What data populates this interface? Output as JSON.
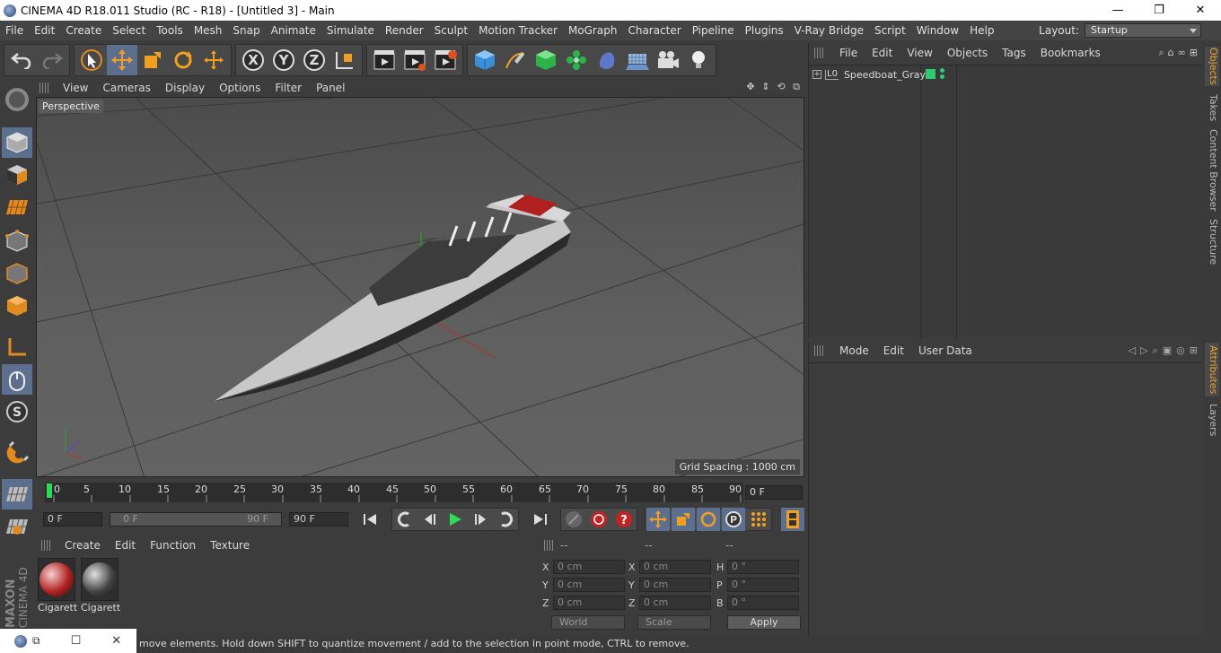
{
  "window": {
    "title": "CINEMA 4D R18.011 Studio (RC - R18) - [Untitled 3] - Main",
    "min_glyph": "—",
    "max_glyph": "❐",
    "close_glyph": "✕"
  },
  "menu": [
    "File",
    "Edit",
    "Create",
    "Select",
    "Tools",
    "Mesh",
    "Snap",
    "Animate",
    "Simulate",
    "Render",
    "Sculpt",
    "Motion Tracker",
    "MoGraph",
    "Character",
    "Pipeline",
    "Plugins",
    "V-Ray Bridge",
    "Script",
    "Window",
    "Help"
  ],
  "layout": {
    "label": "Layout:",
    "value": "Startup"
  },
  "viewport": {
    "menu": [
      "View",
      "Cameras",
      "Display",
      "Options",
      "Filter",
      "Panel"
    ],
    "label": "Perspective",
    "grid_spacing": "Grid Spacing : 1000 cm"
  },
  "timeline": {
    "ticks": [
      "0",
      "5",
      "10",
      "15",
      "20",
      "25",
      "30",
      "35",
      "40",
      "45",
      "50",
      "55",
      "60",
      "65",
      "70",
      "75",
      "80",
      "85",
      "90"
    ],
    "current_frame": "0 F"
  },
  "transport": {
    "start": "0 F",
    "range_start": "0 F",
    "range_end": "90 F",
    "end": "90 F"
  },
  "materials": {
    "menu": [
      "Create",
      "Edit",
      "Function",
      "Texture"
    ],
    "items": [
      {
        "name": "Cigarett",
        "color": "#b22222"
      },
      {
        "name": "Cigarett",
        "color": "#444444"
      }
    ]
  },
  "coords": {
    "headers": [
      "--",
      "--",
      "--"
    ],
    "rows": [
      {
        "l1": "X",
        "v1": "0 cm",
        "l2": "X",
        "v2": "0 cm",
        "l3": "H",
        "v3": "0 °"
      },
      {
        "l1": "Y",
        "v1": "0 cm",
        "l2": "Y",
        "v2": "0 cm",
        "l3": "P",
        "v3": "0 °"
      },
      {
        "l1": "Z",
        "v1": "0 cm",
        "l2": "Z",
        "v2": "0 cm",
        "l3": "B",
        "v3": "0 °"
      }
    ],
    "mode": "World",
    "scale": "Scale",
    "apply": "Apply"
  },
  "objects": {
    "menu": [
      "File",
      "Edit",
      "View",
      "Objects",
      "Tags",
      "Bookmarks"
    ],
    "items": [
      {
        "name": "Speedboat_Gray"
      }
    ]
  },
  "attributes": {
    "menu": [
      "Mode",
      "Edit",
      "User Data"
    ]
  },
  "right_tabs": [
    "Objects",
    "Takes",
    "Content Browser",
    "Structure",
    "Attributes",
    "Layers"
  ],
  "status": "move elements. Hold down SHIFT to quantize movement / add to the selection in point mode, CTRL to remove.",
  "brand": {
    "maxon": "MAXON",
    "product": "CINEMA 4D"
  }
}
